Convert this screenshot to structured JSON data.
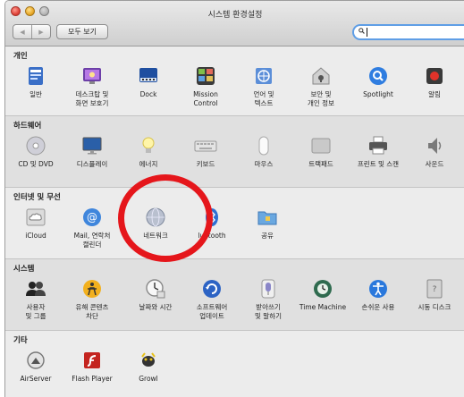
{
  "window": {
    "title": "시스템 환경설정"
  },
  "toolbar": {
    "back": "◀",
    "forward": "▶",
    "show_all_label": "모두 보기"
  },
  "search": {
    "value": "",
    "placeholder": ""
  },
  "sections": [
    {
      "title": "개인",
      "items": [
        {
          "label": "일반",
          "icon": "general-icon"
        },
        {
          "label": "데스크탑 및\n화면 보호기",
          "icon": "desktop-screensaver-icon"
        },
        {
          "label": "Dock",
          "icon": "dock-icon"
        },
        {
          "label": "Mission\nControl",
          "icon": "mission-control-icon"
        },
        {
          "label": "언어 및\n텍스트",
          "icon": "language-text-icon"
        },
        {
          "label": "보안 및\n개인 정보",
          "icon": "security-privacy-icon"
        },
        {
          "label": "Spotlight",
          "icon": "spotlight-icon"
        },
        {
          "label": "알림",
          "icon": "notifications-icon"
        }
      ]
    },
    {
      "title": "하드웨어",
      "items": [
        {
          "label": "CD 및 DVD",
          "icon": "cd-dvd-icon"
        },
        {
          "label": "디스플레이",
          "icon": "displays-icon"
        },
        {
          "label": "에너지",
          "icon": "energy-saver-icon"
        },
        {
          "label": "키보드",
          "icon": "keyboard-icon"
        },
        {
          "label": "마우스",
          "icon": "mouse-icon"
        },
        {
          "label": "트랙패드",
          "icon": "trackpad-icon"
        },
        {
          "label": "프린트 및 스캔",
          "icon": "print-scan-icon"
        },
        {
          "label": "사운드",
          "icon": "sound-icon"
        }
      ]
    },
    {
      "title": "인터넷 및 무선",
      "items": [
        {
          "label": "iCloud",
          "icon": "icloud-icon"
        },
        {
          "label": "Mail, 연락처\n캘린더",
          "icon": "mail-contacts-icon"
        },
        {
          "label": "네트워크",
          "icon": "network-icon"
        },
        {
          "label": "luetooth",
          "icon": "bluetooth-icon"
        },
        {
          "label": "공유",
          "icon": "sharing-icon"
        }
      ]
    },
    {
      "title": "시스템",
      "items": [
        {
          "label": "사용자\n및 그룹",
          "icon": "users-groups-icon"
        },
        {
          "label": "유해 콘텐츠\n차단",
          "icon": "parental-controls-icon"
        },
        {
          "label": "날짜와 시간",
          "icon": "date-time-icon"
        },
        {
          "label": "소프트웨어\n업데이트",
          "icon": "software-update-icon"
        },
        {
          "label": "받아쓰기\n및 말하기",
          "icon": "dictation-speech-icon"
        },
        {
          "label": "Time Machine",
          "icon": "time-machine-icon"
        },
        {
          "label": "손쉬운 사용",
          "icon": "accessibility-icon"
        },
        {
          "label": "시동 디스크",
          "icon": "startup-disk-icon"
        }
      ]
    },
    {
      "title": "기타",
      "items": [
        {
          "label": "AirServer",
          "icon": "airserver-icon"
        },
        {
          "label": "Flash Player",
          "icon": "flash-player-icon"
        },
        {
          "label": "Growl",
          "icon": "growl-icon"
        }
      ]
    }
  ],
  "colors": {
    "annotation": "#e5161b",
    "search_focus": "#5f9ee6"
  }
}
